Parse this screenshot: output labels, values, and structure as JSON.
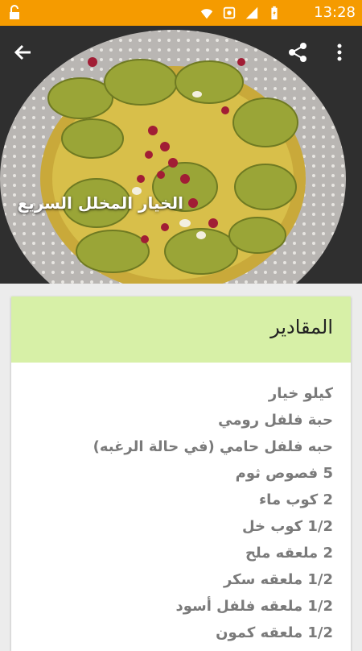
{
  "status": {
    "time": "13:28"
  },
  "recipe": {
    "title": "الخيار المخلل السريع"
  },
  "ingredients": {
    "header": "المقادير",
    "items": [
      "كيلو خيار",
      "حبة فلفل رومي",
      "حبه فلفل حامي (في حالة الرغبه)",
      "5 فصوص ثوم",
      "2 كوب ماء",
      "1/2 كوب خل",
      "2 ملعقه ملح",
      "1/2 ملعقه سكر",
      "1/2 ملعقه فلفل أسود",
      "1/2 ملعقه كمون"
    ]
  }
}
